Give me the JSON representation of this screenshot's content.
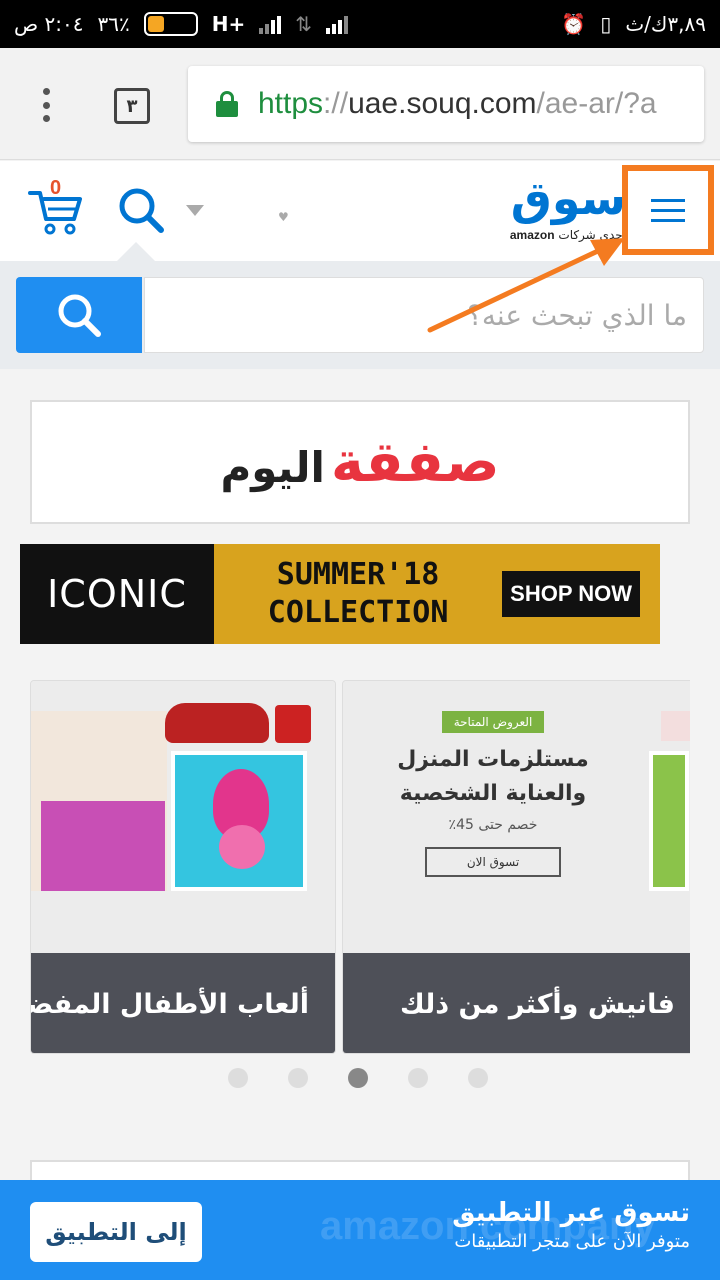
{
  "status_bar": {
    "time": "٢:٠٤ ص",
    "battery": "٣٦٪",
    "network": "H+",
    "data_speed": "٣,٨٩ك/ث",
    "battery_level": 0.36
  },
  "browser": {
    "tab_count": "٣",
    "url_scheme": "https",
    "url_sep": "://",
    "url_host": "uae.souq.com",
    "url_path": "/ae-ar/?a"
  },
  "site_header": {
    "cart_count": "0",
    "logo_text": "سوق",
    "logo_sub_arabic": "إحدى شركات",
    "logo_sub_amazon": "amazon"
  },
  "search": {
    "placeholder": "ما الذي تبحث عنه؟"
  },
  "deal_banner": {
    "red_text": "صفقة",
    "dark_text": "اليوم"
  },
  "iconic_banner": {
    "brand": "ICONIC",
    "line1": "SUMMER'18",
    "line2": "COLLECTION",
    "cta": "SHOP NOW"
  },
  "carousel": {
    "cards": [
      {
        "caption": "ألعاب الأطفال المفضلة"
      },
      {
        "caption": "فانيش وأكثر من ذلك",
        "promo_tag": "العروض المتاحة",
        "promo_title_1": "مستلزمات المنزل",
        "promo_title_2": "والعناية الشخصية",
        "promo_sub": "خصم حتى 45٪",
        "promo_button": "تسوق الان"
      }
    ],
    "active_index": 2,
    "total": 5
  },
  "app_banner": {
    "title": "تسوق عبر التطبيق",
    "subtitle": "متوفر الآن على متجر التطبيقات",
    "button": "إلى التطبيق",
    "watermark": "amazon company"
  },
  "colors": {
    "brand_blue": "#0075d2",
    "highlight_orange": "#f47b20",
    "search_blue": "#1f8ef1"
  }
}
